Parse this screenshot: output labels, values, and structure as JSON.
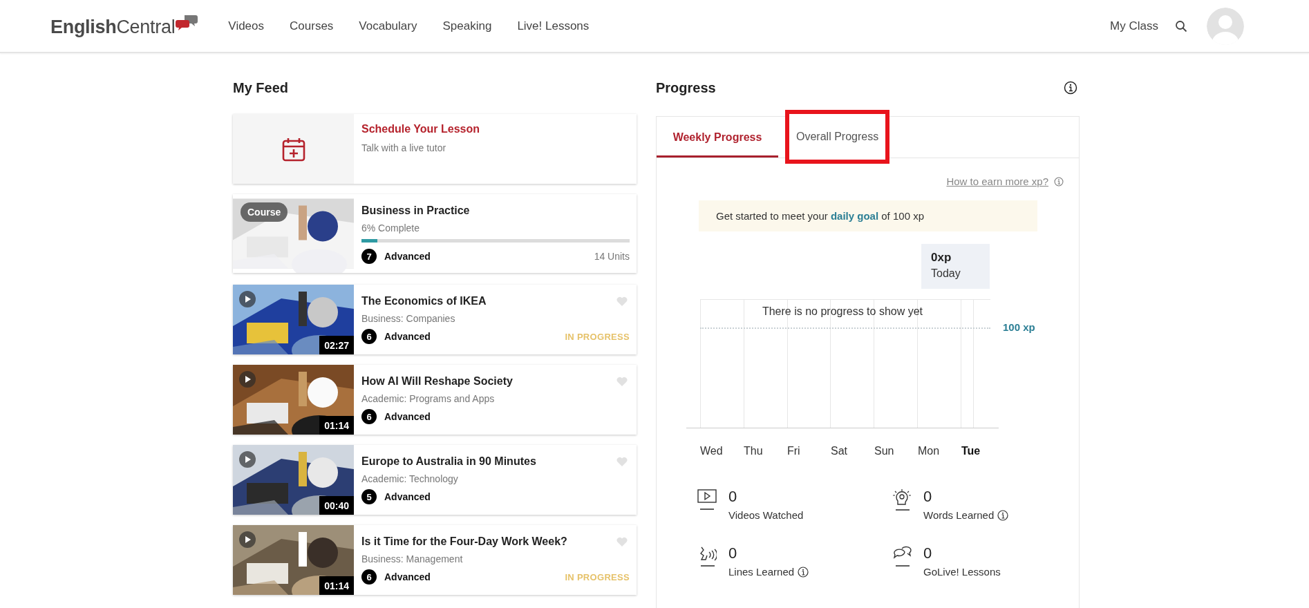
{
  "header": {
    "logo": "**English**Central",
    "nav": [
      {
        "label": "Videos"
      },
      {
        "label": "Courses"
      },
      {
        "label": "Vocabulary"
      },
      {
        "label": "Speaking"
      },
      {
        "label": "Live! Lessons"
      }
    ],
    "my_class": "My Class"
  },
  "feed": {
    "title": "My Feed",
    "items": [
      {
        "kind": "lesson",
        "title": "Schedule Your Lesson",
        "subtitle": "Talk with a live tutor"
      },
      {
        "kind": "course",
        "badge": "Course",
        "title": "Business in Practice",
        "subtitle": "6% Complete",
        "level": 0.06,
        "difficulty": "7",
        "difficulty_label": "Advanced",
        "units": "14 Units"
      },
      {
        "kind": "video",
        "title": "The Economics of IKEA",
        "subtitle": "Business: Companies",
        "difficulty": "6",
        "difficulty_label": "Advanced",
        "duration": "02:27",
        "status": "IN PROGRESS",
        "favorite": false
      },
      {
        "kind": "video",
        "title": "How AI Will Reshape Society",
        "subtitle": "Academic: Programs and Apps",
        "difficulty": "6",
        "difficulty_label": "Advanced",
        "duration": "01:14",
        "favorite": false
      },
      {
        "kind": "video",
        "title": "Europe to Australia in 90 Minutes",
        "subtitle": "Academic: Technology",
        "difficulty": "5",
        "difficulty_label": "Advanced",
        "duration": "00:40",
        "favorite": false
      },
      {
        "kind": "video",
        "title": "Is it Time for the Four-Day Work Week?",
        "subtitle": "Business: Management",
        "difficulty": "6",
        "difficulty_label": "Advanced",
        "duration": "01:14",
        "status": "IN PROGRESS",
        "favorite": false
      }
    ]
  },
  "progress": {
    "title": "Progress",
    "tabs": [
      {
        "label": "Weekly Progress",
        "selected": true,
        "highlighted": false
      },
      {
        "label": "Overall Progress",
        "selected": false,
        "highlighted": true
      }
    ],
    "earn_link": "How to earn more xp?",
    "goal_message": "Get started to meet your **daily goal** of 100 xp",
    "tooltip": {
      "value": "0xp",
      "label": "Today"
    },
    "empty_message": "There is no progress to show yet",
    "goal_line_label": "100 xp",
    "days": [
      {
        "label": "Wed",
        "selected": false
      },
      {
        "label": "Thu",
        "selected": false
      },
      {
        "label": "Fri",
        "selected": false
      },
      {
        "label": "Sat",
        "selected": false
      },
      {
        "label": "Sun",
        "selected": false
      },
      {
        "label": "Mon",
        "selected": false
      },
      {
        "label": "Tue",
        "selected": true
      }
    ],
    "stats": [
      {
        "kind": "videos",
        "value": "0",
        "label": "Videos Watched",
        "info": false
      },
      {
        "kind": "words",
        "value": "0",
        "label": "Words Learned",
        "info": true
      },
      {
        "kind": "lines",
        "value": "0",
        "label": "Lines Learned",
        "info": true
      },
      {
        "kind": "lessons",
        "value": "0",
        "label": "GoLive! Lessons",
        "info": false
      }
    ]
  }
}
